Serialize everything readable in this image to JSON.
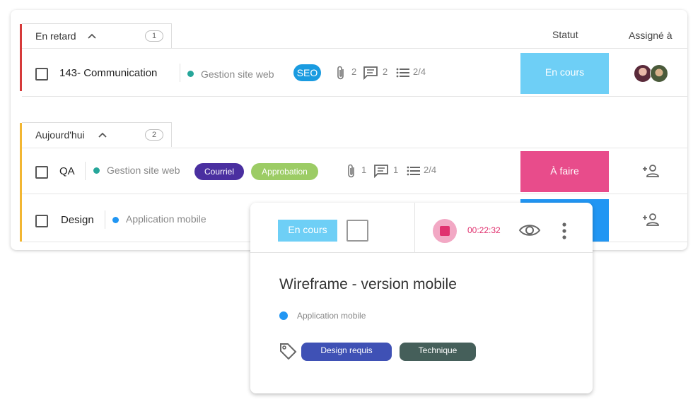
{
  "columns": {
    "status": "Statut",
    "assigned": "Assigné à"
  },
  "groups": [
    {
      "label": "En retard",
      "count": "1",
      "color": "#d63a3a",
      "tasks": [
        {
          "title": "143- Communication",
          "project": "Gestion site web",
          "project_color": "#26a69a",
          "tags": [
            {
              "label": "SEO",
              "color": "#1a9be0"
            }
          ],
          "attachments": "2",
          "comments": "2",
          "checklist": "2/4",
          "status": "En cours",
          "status_color": "#6ecff6"
        }
      ]
    },
    {
      "label": "Aujourd'hui",
      "count": "2",
      "color": "#f2b632",
      "tasks": [
        {
          "title": "QA",
          "project": "Gestion site web",
          "project_color": "#26a69a",
          "tags": [
            {
              "label": "Courriel",
              "color": "#4a2fa0"
            },
            {
              "label": "Approbation",
              "color": "#9ccc65"
            }
          ],
          "attachments": "1",
          "comments": "1",
          "checklist": "2/4",
          "status": "À faire",
          "status_color": "#e84c8b"
        },
        {
          "title": "Design",
          "project": "Application mobile",
          "project_color": "#2196f3",
          "status_color": "#2196f3"
        }
      ]
    }
  ],
  "popup": {
    "status": "En cours",
    "status_color": "#6ecff6",
    "timer": "00:22:32",
    "timer_color": "#e0306e",
    "title": "Wireframe - version mobile",
    "project": "Application mobile",
    "project_color": "#2196f3",
    "tags": [
      {
        "label": "Design requis",
        "color": "#3f51b5"
      },
      {
        "label": "Technique",
        "color": "#455f5a"
      }
    ]
  },
  "icons": {
    "collapse": "chevron-up-icon",
    "attachment": "paperclip-icon",
    "comment": "comment-icon",
    "checklist": "checklist-icon",
    "assign": "add-person-icon",
    "stop": "stop-icon",
    "watch": "eye-icon",
    "more": "more-vertical-icon",
    "tag": "tag-icon"
  }
}
